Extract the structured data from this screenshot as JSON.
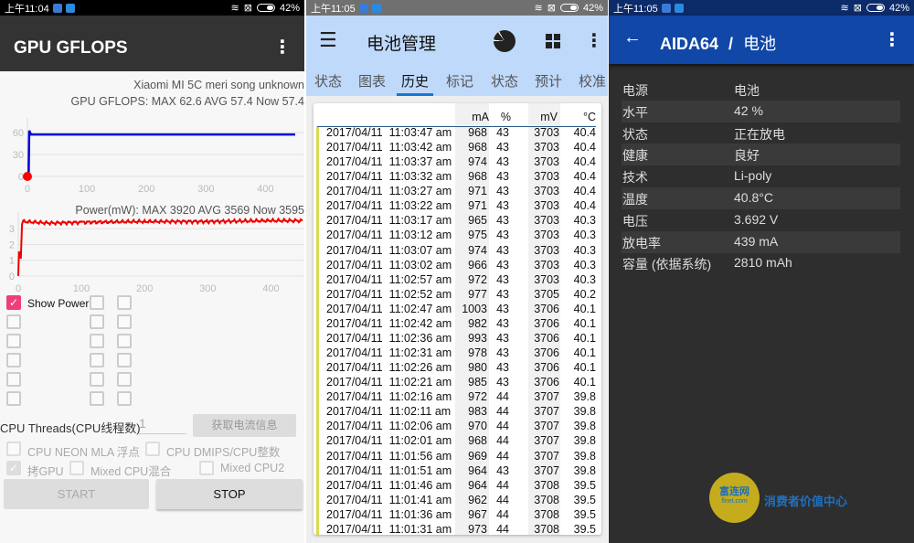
{
  "left": {
    "status": {
      "time": "上午11:04",
      "battery": "42%"
    },
    "title": "GPU GFLOPS",
    "device": "Xiaomi MI 5C meri song unknown",
    "gpu_stats": "GPU GFLOPS: MAX 62.6 AVG 57.4 Now 57.4",
    "power_stats": "Power(mW): MAX 3920 AVG 3569 Now 3595",
    "show_power": "Show Power",
    "cpu_threads_label": "CPU Threads(CPU线程数)",
    "cpu_threads_value": "1",
    "get_current_button": "获取电流信息",
    "opt_neon": "CPU NEON MLA 浮点",
    "opt_dmips": "CPU DMIPS/CPU整数",
    "opt_gpu": "拷GPU",
    "opt_mixed": "Mixed CPU混合",
    "opt_mixed2": "Mixed CPU2",
    "start": "START",
    "stop": "STOP"
  },
  "chart_data": [
    {
      "type": "line",
      "title": "GPU GFLOPS",
      "x_ticks": [
        "0",
        "100",
        "200",
        "300",
        "400"
      ],
      "y_ticks": [
        "0",
        "30",
        "60"
      ],
      "xlim": [
        0,
        450
      ],
      "ylim": [
        0,
        70
      ],
      "series": [
        {
          "name": "GPU GFLOPS",
          "color": "#0000dd",
          "points": [
            [
              0,
              0
            ],
            [
              2,
              0
            ],
            [
              3,
              62.6
            ],
            [
              6,
              57.4
            ],
            [
              450,
              57.4
            ]
          ]
        }
      ]
    },
    {
      "type": "line",
      "title": "Power",
      "x_ticks": [
        "0",
        "100",
        "200",
        "300",
        "400"
      ],
      "y_ticks": [
        "0",
        "1",
        "2",
        "3"
      ],
      "xlim": [
        0,
        450
      ],
      "ylim": [
        0,
        3.7
      ],
      "series": [
        {
          "name": "Power (W)",
          "color": "#ee0000",
          "points": [
            [
              0,
              0
            ],
            [
              1,
              1.5
            ],
            [
              3,
              1.5
            ],
            [
              4,
              1.1
            ],
            [
              6,
              3.3
            ],
            [
              8,
              3.45
            ],
            [
              50,
              3.35
            ],
            [
              100,
              3.4
            ],
            [
              200,
              3.45
            ],
            [
              300,
              3.45
            ],
            [
              400,
              3.5
            ],
            [
              450,
              3.5
            ]
          ]
        }
      ]
    }
  ],
  "mid": {
    "status": {
      "time": "上午11:05",
      "battery": "42%"
    },
    "title": "电池管理",
    "tabs": [
      "状态",
      "图表",
      "历史",
      "标记",
      "状态",
      "预计",
      "校准"
    ],
    "headers": [
      "mA",
      "%",
      "mV",
      "°C"
    ],
    "rows": [
      [
        "2017/04/11  11:03:47 am",
        "968",
        "43",
        "3703",
        "40.4"
      ],
      [
        "2017/04/11  11:03:42 am",
        "968",
        "43",
        "3703",
        "40.4"
      ],
      [
        "2017/04/11  11:03:37 am",
        "974",
        "43",
        "3703",
        "40.4"
      ],
      [
        "2017/04/11  11:03:32 am",
        "968",
        "43",
        "3703",
        "40.4"
      ],
      [
        "2017/04/11  11:03:27 am",
        "971",
        "43",
        "3703",
        "40.4"
      ],
      [
        "2017/04/11  11:03:22 am",
        "971",
        "43",
        "3703",
        "40.4"
      ],
      [
        "2017/04/11  11:03:17 am",
        "965",
        "43",
        "3703",
        "40.3"
      ],
      [
        "2017/04/11  11:03:12 am",
        "975",
        "43",
        "3703",
        "40.3"
      ],
      [
        "2017/04/11  11:03:07 am",
        "974",
        "43",
        "3703",
        "40.3"
      ],
      [
        "2017/04/11  11:03:02 am",
        "966",
        "43",
        "3703",
        "40.3"
      ],
      [
        "2017/04/11  11:02:57 am",
        "972",
        "43",
        "3703",
        "40.3"
      ],
      [
        "2017/04/11  11:02:52 am",
        "977",
        "43",
        "3705",
        "40.2"
      ],
      [
        "2017/04/11  11:02:47 am",
        "1003",
        "43",
        "3706",
        "40.1"
      ],
      [
        "2017/04/11  11:02:42 am",
        "982",
        "43",
        "3706",
        "40.1"
      ],
      [
        "2017/04/11  11:02:36 am",
        "993",
        "43",
        "3706",
        "40.1"
      ],
      [
        "2017/04/11  11:02:31 am",
        "978",
        "43",
        "3706",
        "40.1"
      ],
      [
        "2017/04/11  11:02:26 am",
        "980",
        "43",
        "3706",
        "40.1"
      ],
      [
        "2017/04/11  11:02:21 am",
        "985",
        "43",
        "3706",
        "40.1"
      ],
      [
        "2017/04/11  11:02:16 am",
        "972",
        "44",
        "3707",
        "39.8"
      ],
      [
        "2017/04/11  11:02:11 am",
        "983",
        "44",
        "3707",
        "39.8"
      ],
      [
        "2017/04/11  11:02:06 am",
        "970",
        "44",
        "3707",
        "39.8"
      ],
      [
        "2017/04/11  11:02:01 am",
        "968",
        "44",
        "3707",
        "39.8"
      ],
      [
        "2017/04/11  11:01:56 am",
        "969",
        "44",
        "3707",
        "39.8"
      ],
      [
        "2017/04/11  11:01:51 am",
        "964",
        "43",
        "3707",
        "39.8"
      ],
      [
        "2017/04/11  11:01:46 am",
        "964",
        "44",
        "3708",
        "39.5"
      ],
      [
        "2017/04/11  11:01:41 am",
        "962",
        "44",
        "3708",
        "39.5"
      ],
      [
        "2017/04/11  11:01:36 am",
        "967",
        "44",
        "3708",
        "39.5"
      ],
      [
        "2017/04/11  11:01:31 am",
        "973",
        "44",
        "3708",
        "39.5"
      ]
    ]
  },
  "right": {
    "status": {
      "time": "上午11:05",
      "battery": "42%"
    },
    "app": "AIDA64",
    "sep": "/",
    "page": "电池",
    "items": [
      [
        "电源",
        "电池"
      ],
      [
        "水平",
        "42 %"
      ],
      [
        "状态",
        "正在放电"
      ],
      [
        "健康",
        "良好"
      ],
      [
        "技术",
        "Li-poly"
      ],
      [
        "温度",
        "40.8°C"
      ],
      [
        "电压",
        "3.692 V"
      ],
      [
        "放电率",
        "439 mA"
      ],
      [
        "容量 (依据系统)",
        "2810 mAh"
      ]
    ],
    "watermark": {
      "logo": "富连网",
      "domain": "flnet.com",
      "slogan": "消费者价值中心"
    }
  }
}
